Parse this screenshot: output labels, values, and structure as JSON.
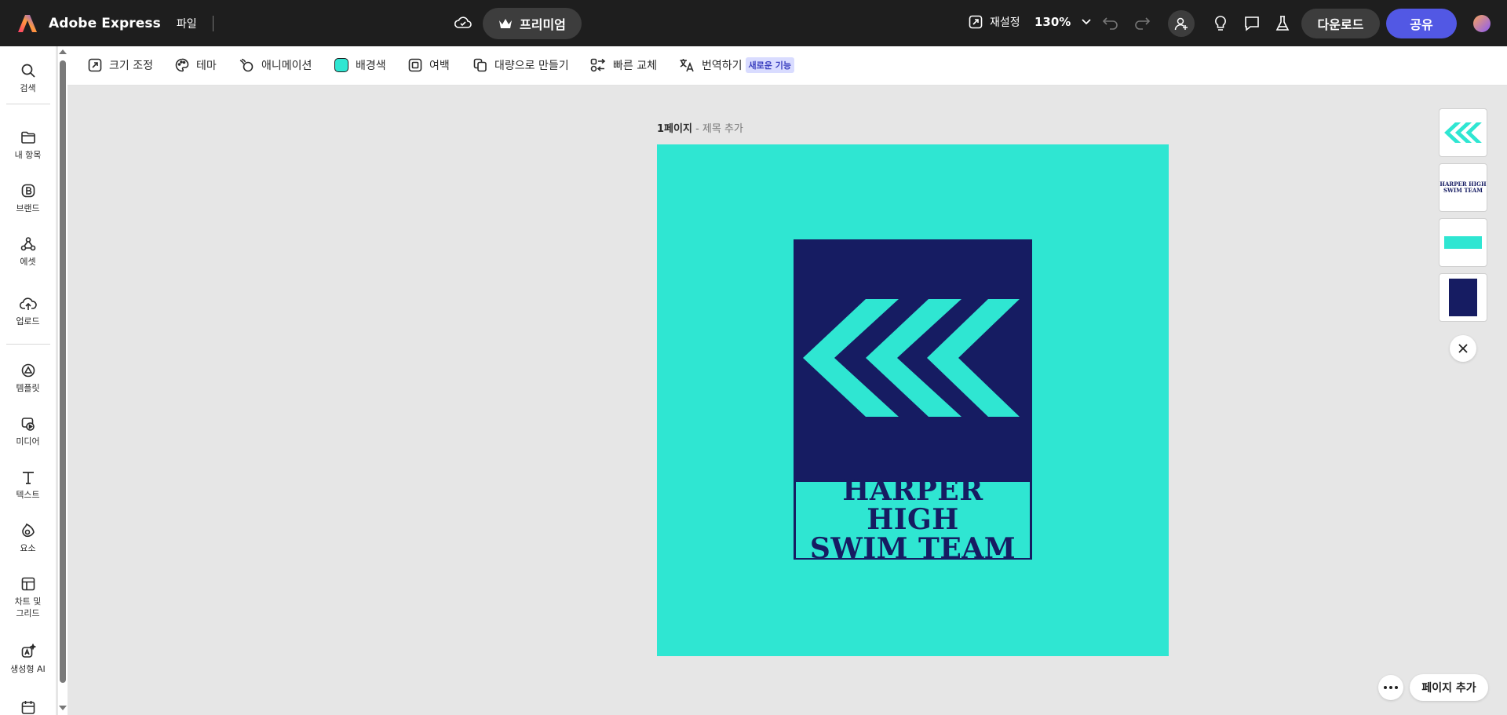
{
  "header": {
    "app_name": "Adobe Express",
    "file_menu": "파일",
    "premium_label": "프리미엄",
    "resize_label": "재설정",
    "zoom_level": "130%",
    "download_label": "다운로드",
    "share_label": "공유"
  },
  "sidebar": {
    "items": [
      {
        "label": "검색",
        "icon": "search-icon"
      },
      {
        "label": "내 항목",
        "icon": "folder-icon"
      },
      {
        "label": "브랜드",
        "icon": "brand-icon"
      },
      {
        "label": "에셋",
        "icon": "assets-icon"
      },
      {
        "label": "업로드",
        "icon": "upload-icon"
      },
      {
        "label": "템플릿",
        "icon": "template-icon"
      },
      {
        "label": "미디어",
        "icon": "media-icon"
      },
      {
        "label": "텍스트",
        "icon": "text-icon"
      },
      {
        "label": "요소",
        "icon": "elements-icon"
      },
      {
        "label": "차트 및 그리드",
        "icon": "chart-grid-icon"
      },
      {
        "label": "생성형 AI",
        "icon": "ai-icon"
      }
    ]
  },
  "toolbar": {
    "resize": "크기 조정",
    "theme": "테마",
    "animation": "애니메이션",
    "background_color": "배경색",
    "padding": "여백",
    "bulk_create": "대량으로 만들기",
    "quick_replace": "빠른 교체",
    "translate": "번역하기",
    "new_feature_badge": "새로운 기능"
  },
  "canvas": {
    "page_label": "1페이지",
    "page_title_placeholder": "- 제목 추가",
    "logo_line1": "HARPER HIGH",
    "logo_line2": "SWIM TEAM"
  },
  "bottom": {
    "add_page": "페이지 추가"
  },
  "colors": {
    "accent": "#5258e4",
    "canvas_bg": "#2fe6d2",
    "logo_navy": "#161c62",
    "topbar": "#1e1e1e"
  }
}
